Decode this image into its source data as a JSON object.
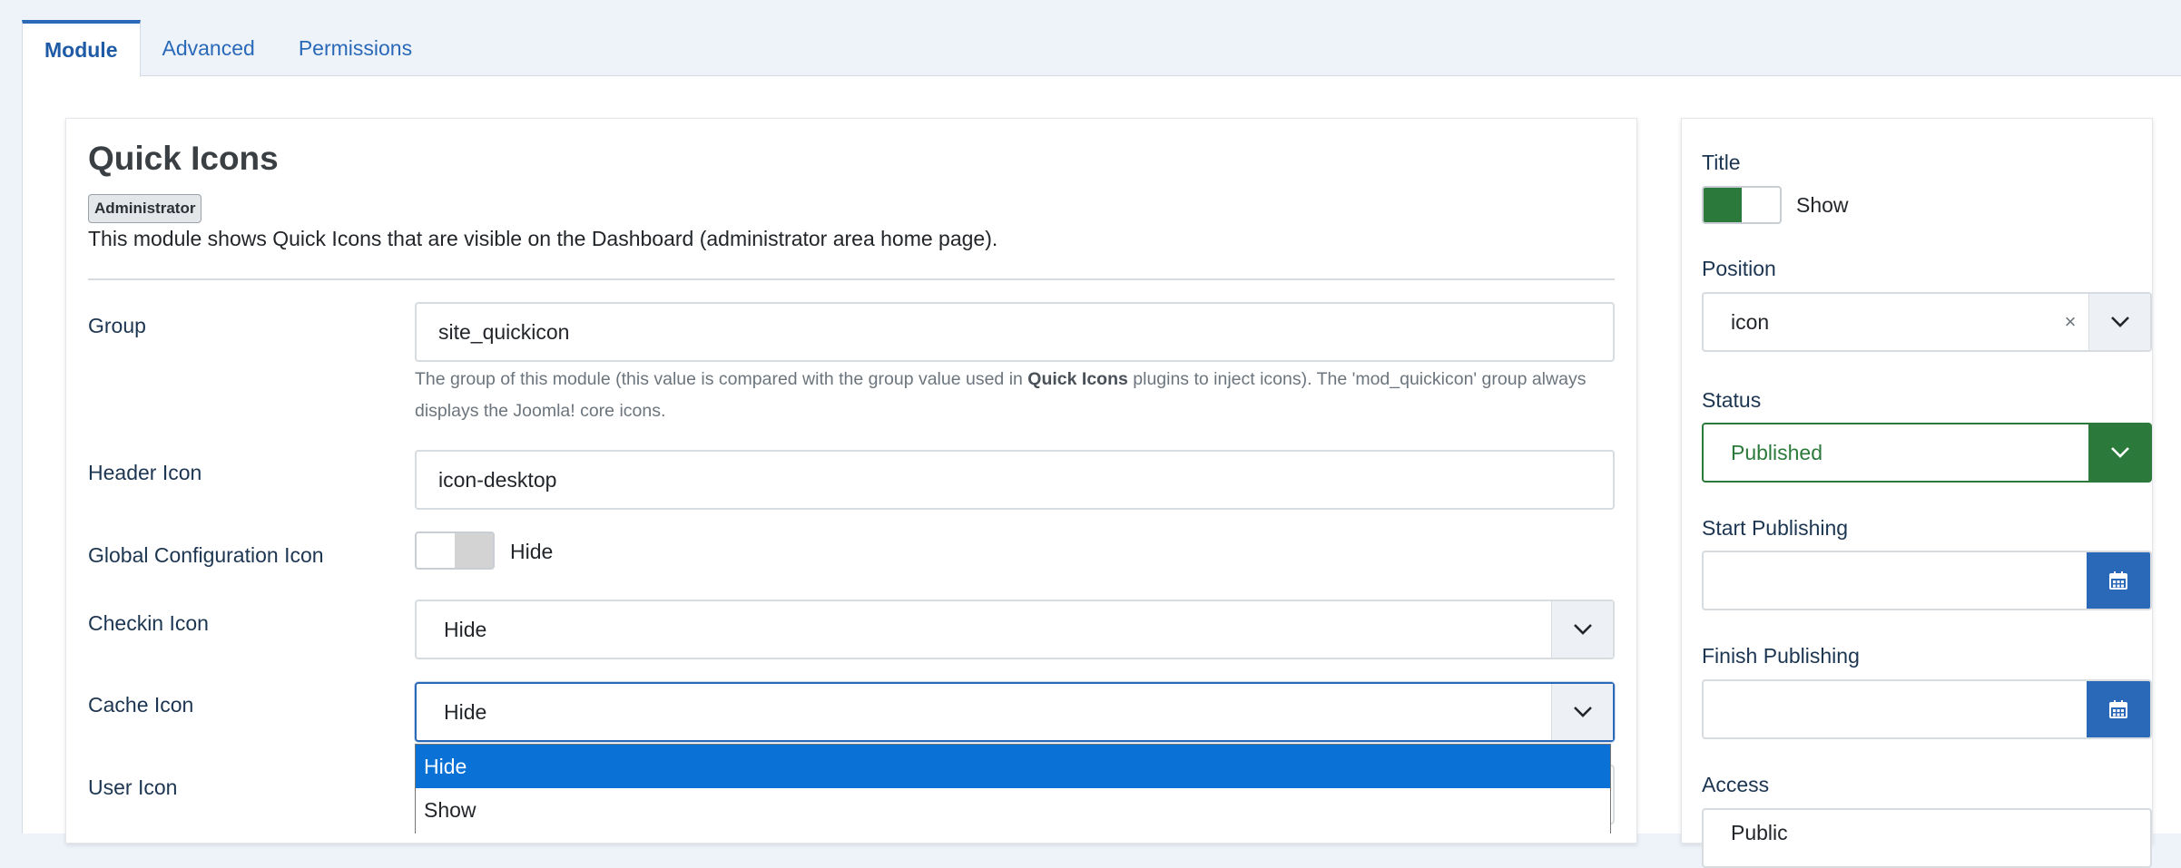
{
  "tabs": [
    {
      "label": "Module",
      "active": true
    },
    {
      "label": "Advanced",
      "active": false
    },
    {
      "label": "Permissions",
      "active": false
    }
  ],
  "module": {
    "title": "Quick Icons",
    "badge": "Administrator",
    "description": "This module shows Quick Icons that are visible on the Dashboard (administrator area home page)."
  },
  "fields": {
    "group": {
      "label": "Group",
      "value": "site_quickicon",
      "help_part1": "The group of this module (this value is compared with the group value used in ",
      "help_bold": "Quick Icons",
      "help_part2": " plugins to inject icons). The 'mod_quickicon' group always displays the Joomla! core icons."
    },
    "header_icon": {
      "label": "Header Icon",
      "value": "icon-desktop"
    },
    "global_config_icon": {
      "label": "Global Configuration Icon",
      "state": "Hide"
    },
    "checkin_icon": {
      "label": "Checkin Icon",
      "value": "Hide"
    },
    "cache_icon": {
      "label": "Cache Icon",
      "value": "Hide",
      "options": [
        "Hide",
        "Show"
      ]
    },
    "user_icon": {
      "label": "User Icon"
    }
  },
  "sidebar": {
    "title": {
      "label": "Title",
      "state": "Show"
    },
    "position": {
      "label": "Position",
      "value": "icon",
      "clear": "×"
    },
    "status": {
      "label": "Status",
      "value": "Published"
    },
    "start_publishing": {
      "label": "Start Publishing",
      "value": ""
    },
    "finish_publishing": {
      "label": "Finish Publishing",
      "value": ""
    },
    "access": {
      "label": "Access",
      "value": "Public"
    }
  },
  "colors": {
    "accent": "#2a69b8",
    "success": "#2b7a3b",
    "dropdown_selected": "#0a72d6"
  }
}
